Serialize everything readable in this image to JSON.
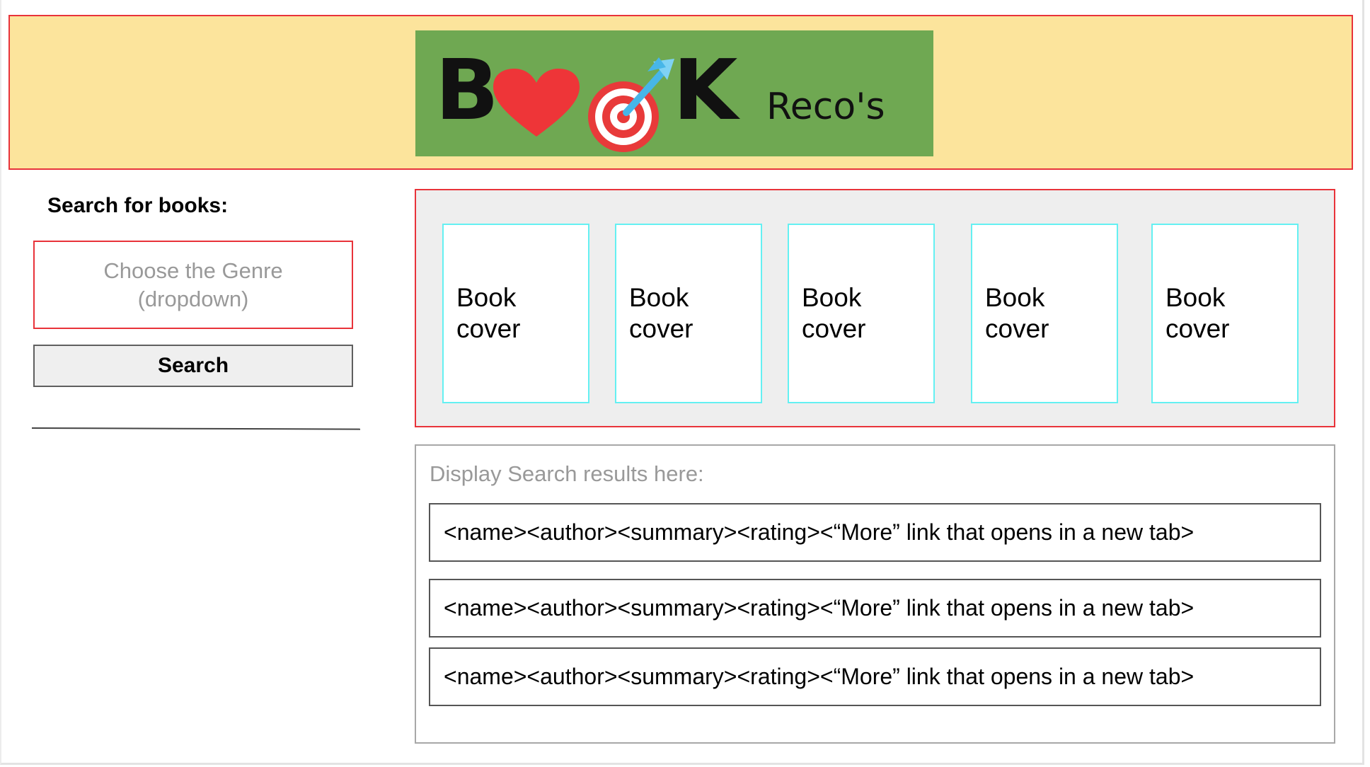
{
  "header": {
    "logo": {
      "wordmark_left": "B",
      "wordmark_right": "K",
      "tagline": "Reco's",
      "heart_icon": "heart-icon",
      "target_icon": "target-with-dart-icon",
      "background_color": "#6fa852"
    },
    "background_color": "#fce49c"
  },
  "sidebar": {
    "title": "Search for books:",
    "genre_dropdown": {
      "placeholder": "Choose the Genre\n(dropdown)"
    },
    "search_button_label": "Search"
  },
  "covers": {
    "items": [
      {
        "label": "Book\ncover"
      },
      {
        "label": "Book\ncover"
      },
      {
        "label": "Book\ncover"
      },
      {
        "label": "Book\ncover"
      },
      {
        "label": "Book\ncover"
      }
    ]
  },
  "results": {
    "label": "Display Search results here:",
    "rows": [
      {
        "text": "<name><author><summary><rating><“More” link that opens in a new tab>"
      },
      {
        "text": "<name><author><summary><rating><“More” link that opens in a new tab>"
      },
      {
        "text": "<name><author><summary><rating><“More” link that opens in a new tab>"
      }
    ]
  },
  "colors": {
    "accent_border": "#e8333a",
    "cover_border": "#64f0f2",
    "heart": "#ee3538",
    "target": "#e83a3a",
    "dart": "#47b6e8"
  }
}
